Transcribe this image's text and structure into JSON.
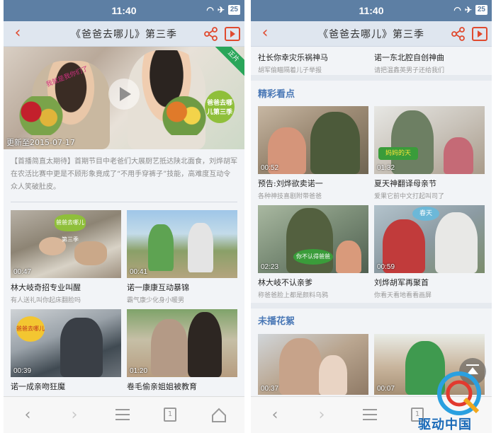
{
  "status": {
    "time": "11:40",
    "battery": "25"
  },
  "nav": {
    "title": "《爸爸去哪儿》第三季"
  },
  "hero": {
    "update_text": "更新至2015-07-17",
    "tag": "正片",
    "badge_text": "爸爸去哪儿第三季",
    "handwritten": "我就是我你们了"
  },
  "description": "【首播简直太期待】首期节目中老爸们大展厨艺抵达陕北面食，刘烨胡军在农活比赛中更是不顾形象竟成了“不用手穿裤子”技能，高难度互动令众人笑破肚皮。",
  "left_tiles": [
    {
      "duration": "00:47",
      "title": "林大岐奇招专业叫醒",
      "sub": "有人送礼叫你起床翻脸吗",
      "overlay": "爸爸去哪儿 第三季"
    },
    {
      "duration": "00:41",
      "title": "诺一康康互动暴锦",
      "sub": "霸气康少化身小暖男",
      "overlay": ""
    },
    {
      "duration": "00:39",
      "title": "诺一成亲吻狂魔",
      "sub": "",
      "overlay": "爸爸去哪儿"
    },
    {
      "duration": "01:20",
      "title": "卷毛偷亲姐姐被教育",
      "sub": "",
      "overlay": ""
    }
  ],
  "right_top": [
    {
      "title": "社长你幸灾乐祸神马",
      "sub": "胡军偷瞄隔着儿子举报"
    },
    {
      "title": "诺一东北腔自创神曲",
      "sub": "请把温鑫英男子还给我们"
    }
  ],
  "sections": {
    "highlights": "精彩看点",
    "unaired": "未播花絮"
  },
  "highlight_tiles": [
    {
      "duration": "00:52",
      "title": "预告:刘烨欲卖诺一",
      "sub": "各种神技喜剧附带爸爸"
    },
    {
      "duration": "01:32",
      "title": "夏天神翻译母亲节",
      "sub": "爱果它前中文打起叫司了",
      "overlay": "妈妈的天"
    },
    {
      "duration": "02:23",
      "title": "林大岐不认亲爹",
      "sub": "称爸爸脸上都是颜料乌鸦",
      "overlay": "你不认得爸爸"
    },
    {
      "duration": "00:59",
      "title": "刘烨胡军再聚首",
      "sub": "你看天看地看看画屏",
      "overlay": "春天"
    }
  ],
  "unaired_tiles": [
    {
      "duration": "00:37"
    },
    {
      "duration": "00:07"
    }
  ],
  "bottombar": {
    "page_count": "1"
  },
  "watermark": {
    "text": "驱动中国"
  },
  "colors": {
    "status_bar": "#5d7fa4",
    "accent": "#e04a2f",
    "section_title": "#4a78b6",
    "nav_bg": "#dfe6ef"
  }
}
